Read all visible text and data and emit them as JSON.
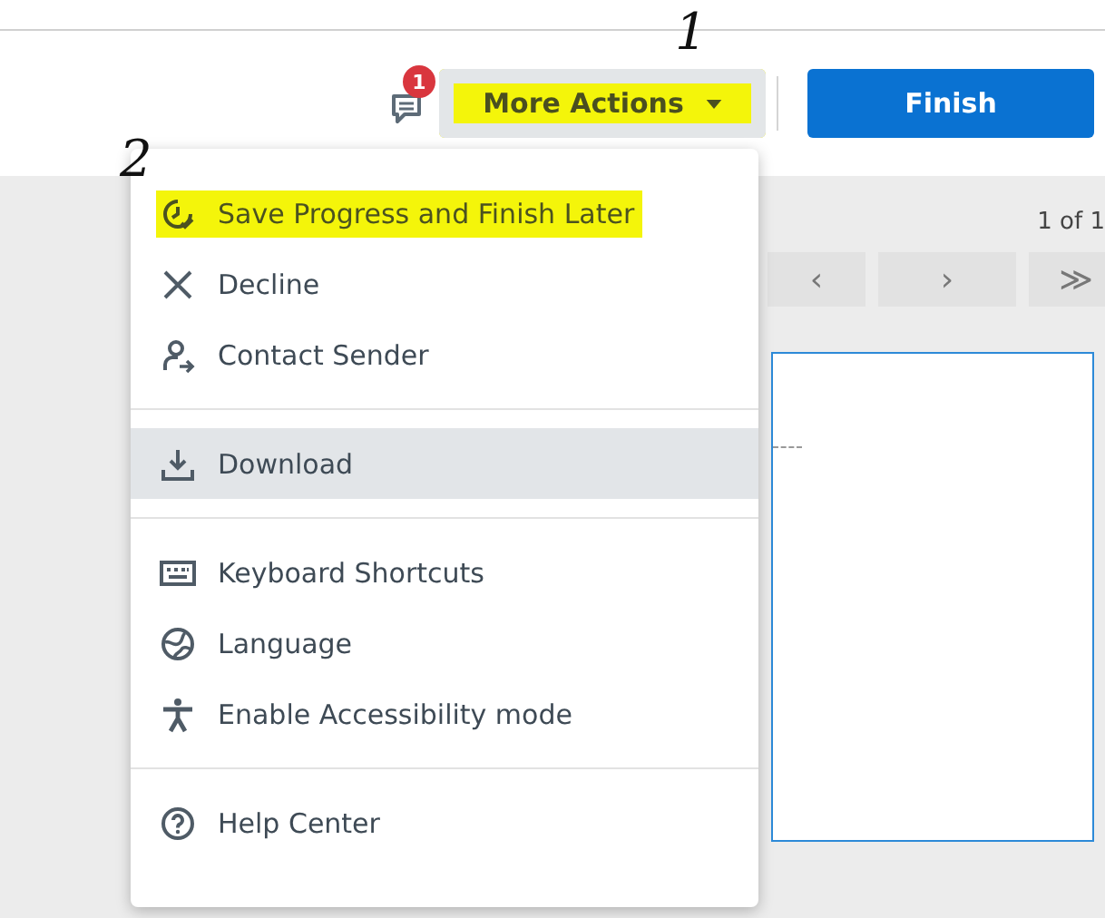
{
  "toolbar": {
    "comments": {
      "badge": "1"
    },
    "more_actions": {
      "label": "More Actions",
      "highlighted": true,
      "expanded": true
    },
    "finish": {
      "label": "Finish"
    }
  },
  "pager": {
    "page_label": "1 of 1",
    "buttons": [
      {
        "label": "‹",
        "kind": "prev"
      },
      {
        "label": "›",
        "kind": "next"
      },
      {
        "label": "≫",
        "kind": "last"
      }
    ]
  },
  "menu": {
    "groups": [
      [
        {
          "label": "Save Progress and Finish Later",
          "kind": "save",
          "highlighted": true,
          "hovered": false
        },
        {
          "label": "Decline",
          "kind": "decline",
          "highlighted": false,
          "hovered": false
        },
        {
          "label": "Contact Sender",
          "kind": "contact",
          "highlighted": false,
          "hovered": false
        }
      ],
      [
        {
          "label": "Download",
          "kind": "download",
          "highlighted": false,
          "hovered": true
        }
      ],
      [
        {
          "label": "Keyboard Shortcuts",
          "kind": "keyboard",
          "highlighted": false,
          "hovered": false
        },
        {
          "label": "Language",
          "kind": "language",
          "highlighted": false,
          "hovered": false
        },
        {
          "label": "Enable Accessibility mode",
          "kind": "accessibility",
          "highlighted": false,
          "hovered": false
        }
      ],
      [
        {
          "label": "Help Center",
          "kind": "help",
          "highlighted": false,
          "hovered": false
        }
      ]
    ]
  },
  "annotations": [
    {
      "text": "1",
      "kind": "button"
    },
    {
      "text": "2",
      "kind": "menu"
    }
  ]
}
